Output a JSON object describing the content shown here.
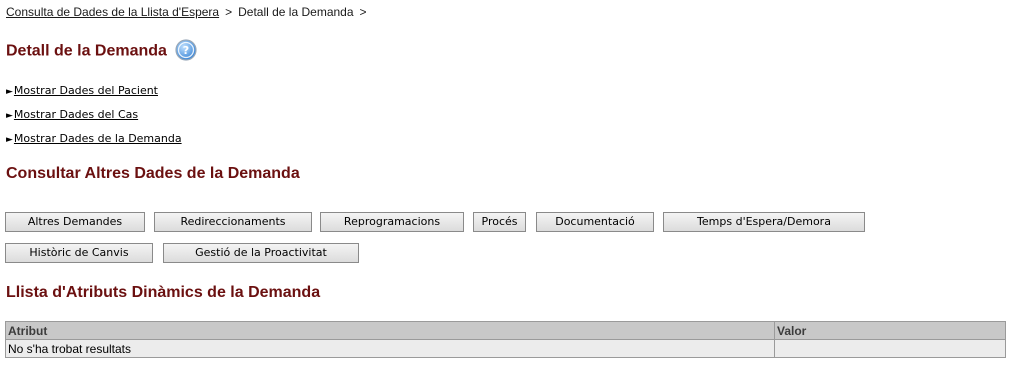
{
  "breadcrumb": {
    "link": "Consulta de Dades de la Llista d'Espera",
    "separator": ">",
    "current": "Detall de la Demanda",
    "trailing_separator": ">"
  },
  "detail": {
    "title": "Detall de la Demanda",
    "help_icon": "help-question-icon"
  },
  "expanders": {
    "arrow": "►",
    "items": [
      "Mostrar Dades del Pacient",
      "Mostrar Dades del Cas",
      "Mostrar Dades de la Demanda"
    ]
  },
  "other_data": {
    "title": "Consultar Altres Dades de la Demanda",
    "buttons": [
      "Altres Demandes",
      "Redireccionaments",
      "Reprogramacions",
      "Procés",
      "Documentació",
      "Temps d'Espera/Demora",
      "Històric de Canvis",
      "Gestió de la Proactivitat"
    ]
  },
  "attributes": {
    "title": "Llista d'Atributs Dinàmics de la Demanda",
    "columns": [
      "Atribut",
      "Valor"
    ],
    "empty_message": "No s'ha trobat resultats",
    "empty_value": ""
  },
  "colors": {
    "heading": "#6b1010",
    "table_header": "#c8c8c8",
    "table_row": "#ececec",
    "help_icon": "#4a90d9"
  }
}
